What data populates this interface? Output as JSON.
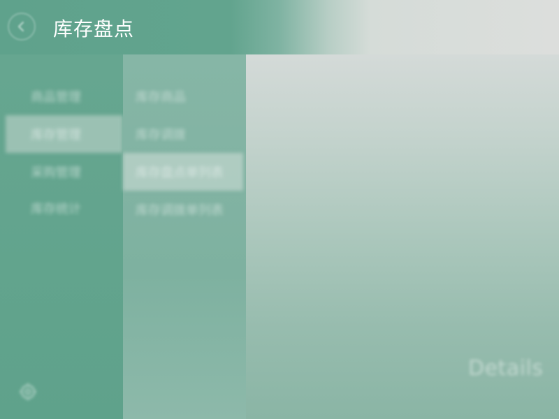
{
  "header": {
    "title": "库存盘点",
    "back_icon": "arrow-left-icon"
  },
  "nav_primary": {
    "items": [
      {
        "label": "商品管理",
        "selected": false
      },
      {
        "label": "库存管理",
        "selected": true
      },
      {
        "label": "采购管理",
        "selected": false
      },
      {
        "label": "库存统计",
        "selected": false
      }
    ],
    "settings_icon": "settings-icon"
  },
  "nav_secondary": {
    "items": [
      {
        "label": "库存商品",
        "selected": false
      },
      {
        "label": "库存调拨",
        "selected": false
      },
      {
        "label": "库存盘点单列表",
        "selected": true
      },
      {
        "label": "库存调拨单列表",
        "selected": false
      }
    ]
  },
  "content": {
    "details_label": "Details"
  },
  "colors": {
    "accent": "#5fa28b",
    "header_fade": "#dcdedc"
  }
}
